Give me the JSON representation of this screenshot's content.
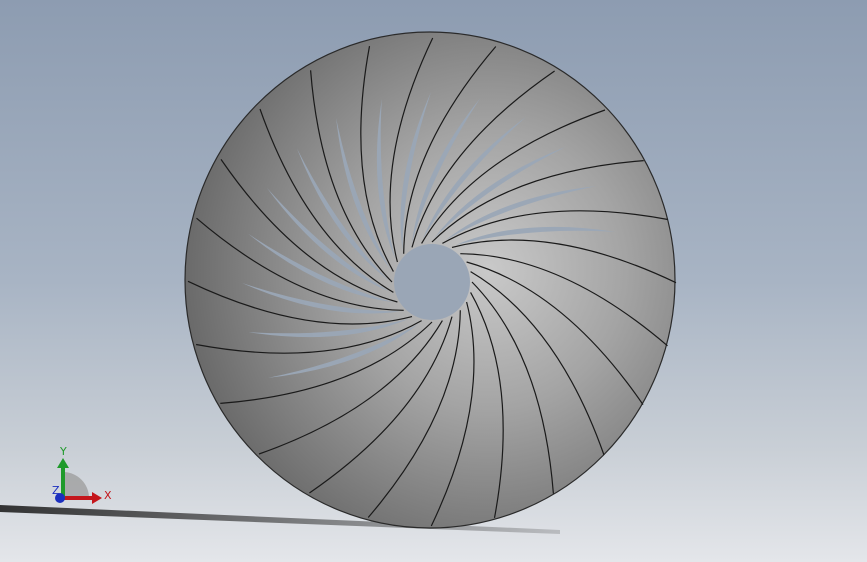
{
  "triad": {
    "x_label": "X",
    "y_label": "Y",
    "z_label": "Z",
    "x_color": "#c4161c",
    "y_color": "#1f9a2b",
    "z_color": "#1b2fbf"
  },
  "model": {
    "blade_count": 24,
    "body_color": "#7a7a7a",
    "blade_edge_color": "#1a1a1a"
  }
}
